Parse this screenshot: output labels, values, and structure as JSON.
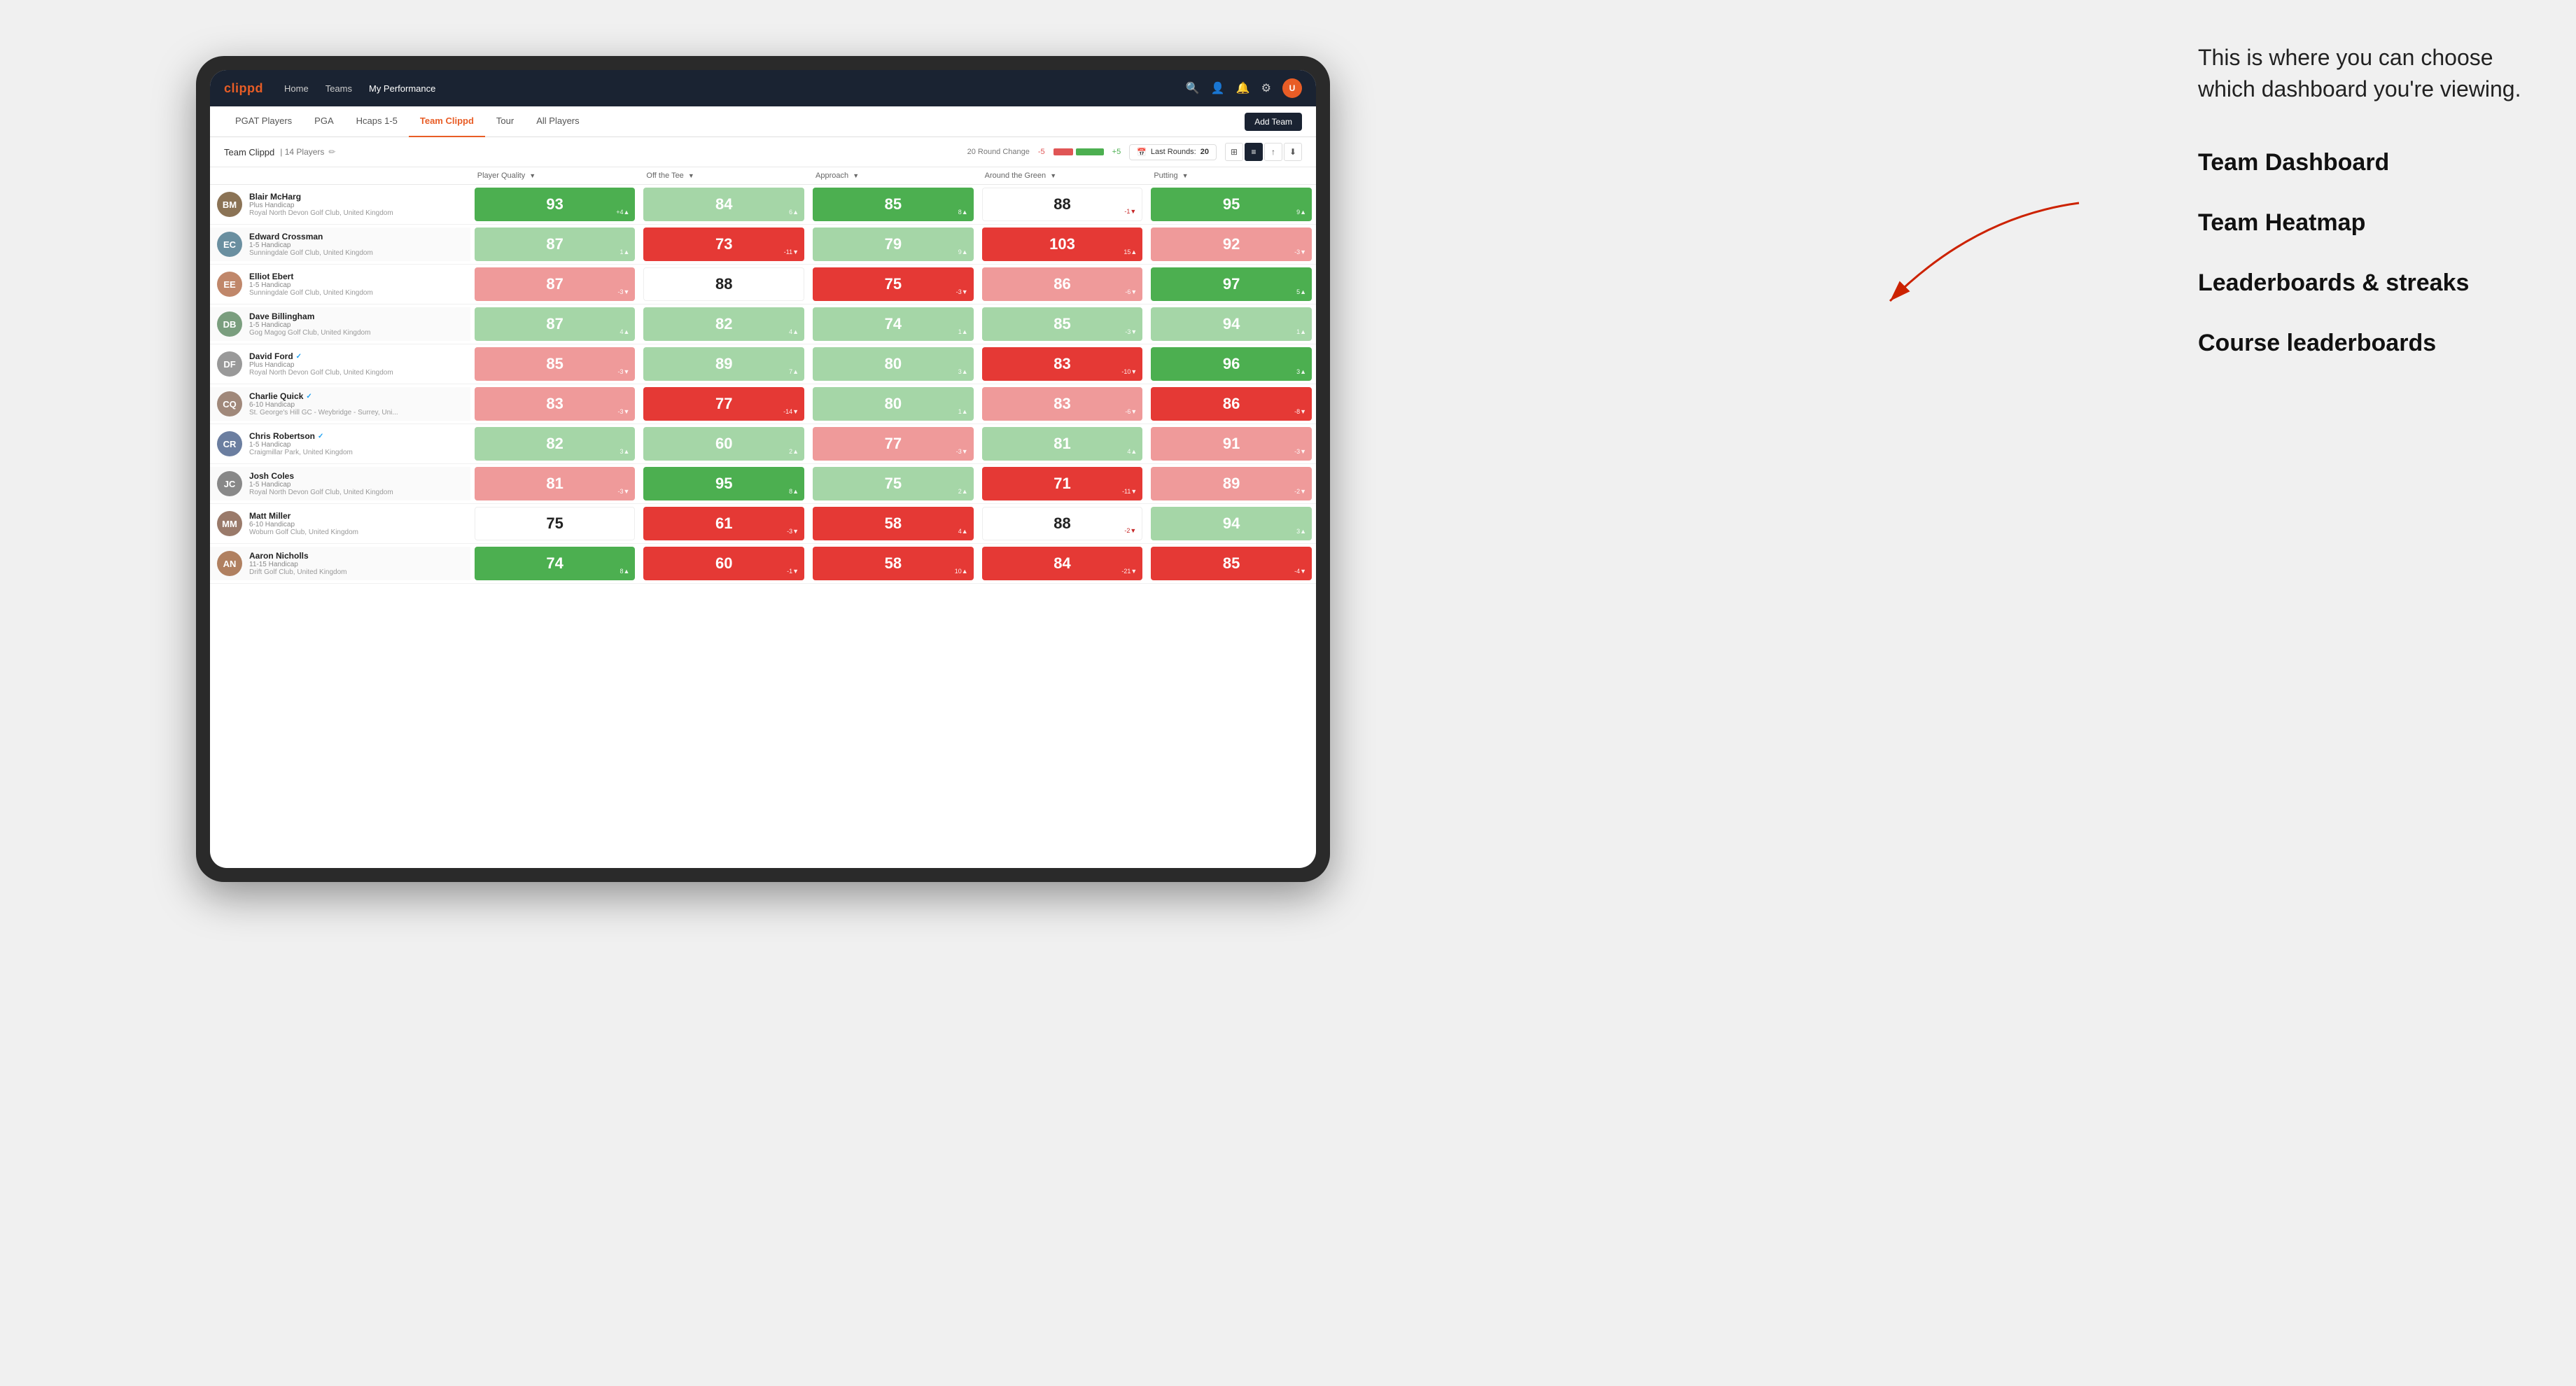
{
  "annotation": {
    "intro": "This is where you can choose which dashboard you're viewing.",
    "options": [
      "Team Dashboard",
      "Team Heatmap",
      "Leaderboards & streaks",
      "Course leaderboards"
    ]
  },
  "navbar": {
    "brand": "clippd",
    "nav_items": [
      "Home",
      "Teams",
      "My Performance"
    ],
    "active_nav": "My Performance"
  },
  "subnav": {
    "items": [
      "PGAT Players",
      "PGA",
      "Hcaps 1-5",
      "Team Clippd",
      "Tour",
      "All Players"
    ],
    "active_item": "Team Clippd",
    "add_team_label": "Add Team"
  },
  "team_header": {
    "name": "Team Clippd",
    "separator": "|",
    "count": "14 Players",
    "round_change_label": "20 Round Change",
    "minus": "-5",
    "plus": "+5",
    "last_rounds_label": "Last Rounds:",
    "last_rounds_value": "20"
  },
  "table": {
    "columns": [
      "Player Quality ↓",
      "Off the Tee ↓",
      "Approach ↓",
      "Around the Green ↓",
      "Putting ↓"
    ],
    "players": [
      {
        "name": "Blair McHarg",
        "handicap": "Plus Handicap",
        "club": "Royal North Devon Golf Club, United Kingdom",
        "avatar_color": "#8B7355",
        "initials": "BM",
        "scores": [
          {
            "value": 93,
            "change": "+4",
            "dir": "up",
            "bg": "green-dark"
          },
          {
            "value": 84,
            "change": "6",
            "dir": "up",
            "bg": "green-light"
          },
          {
            "value": 85,
            "change": "8",
            "dir": "up",
            "bg": "green-dark"
          },
          {
            "value": 88,
            "change": "-1",
            "dir": "down",
            "bg": "white"
          },
          {
            "value": 95,
            "change": "9",
            "dir": "up",
            "bg": "green-dark"
          }
        ]
      },
      {
        "name": "Edward Crossman",
        "handicap": "1-5 Handicap",
        "club": "Sunningdale Golf Club, United Kingdom",
        "avatar_color": "#6a8fa0",
        "initials": "EC",
        "scores": [
          {
            "value": 87,
            "change": "1",
            "dir": "up",
            "bg": "green-light"
          },
          {
            "value": 73,
            "change": "-11",
            "dir": "down",
            "bg": "red-dark"
          },
          {
            "value": 79,
            "change": "9",
            "dir": "up",
            "bg": "green-light"
          },
          {
            "value": 103,
            "change": "15",
            "dir": "up",
            "bg": "red-dark"
          },
          {
            "value": 92,
            "change": "-3",
            "dir": "down",
            "bg": "red-light"
          }
        ]
      },
      {
        "name": "Elliot Ebert",
        "handicap": "1-5 Handicap",
        "club": "Sunningdale Golf Club, United Kingdom",
        "avatar_color": "#c0876a",
        "initials": "EE",
        "scores": [
          {
            "value": 87,
            "change": "-3",
            "dir": "down",
            "bg": "red-light"
          },
          {
            "value": 88,
            "change": "",
            "dir": "",
            "bg": "white"
          },
          {
            "value": 75,
            "change": "-3",
            "dir": "down",
            "bg": "red-dark"
          },
          {
            "value": 86,
            "change": "-6",
            "dir": "down",
            "bg": "red-light"
          },
          {
            "value": 97,
            "change": "5",
            "dir": "up",
            "bg": "green-dark"
          }
        ]
      },
      {
        "name": "Dave Billingham",
        "handicap": "1-5 Handicap",
        "club": "Gog Magog Golf Club, United Kingdom",
        "avatar_color": "#7a9e7e",
        "initials": "DB",
        "scores": [
          {
            "value": 87,
            "change": "4",
            "dir": "up",
            "bg": "green-light"
          },
          {
            "value": 82,
            "change": "4",
            "dir": "up",
            "bg": "green-light"
          },
          {
            "value": 74,
            "change": "1",
            "dir": "up",
            "bg": "green-light"
          },
          {
            "value": 85,
            "change": "-3",
            "dir": "down",
            "bg": "green-light"
          },
          {
            "value": 94,
            "change": "1",
            "dir": "up",
            "bg": "green-light"
          }
        ]
      },
      {
        "name": "David Ford",
        "handicap": "Plus Handicap",
        "club": "Royal North Devon Golf Club, United Kingdom",
        "avatar_color": "#888",
        "initials": "DF",
        "verified": true,
        "scores": [
          {
            "value": 85,
            "change": "-3",
            "dir": "down",
            "bg": "red-light"
          },
          {
            "value": 89,
            "change": "7",
            "dir": "up",
            "bg": "green-light"
          },
          {
            "value": 80,
            "change": "3",
            "dir": "up",
            "bg": "green-light"
          },
          {
            "value": 83,
            "change": "-10",
            "dir": "down",
            "bg": "red-dark"
          },
          {
            "value": 96,
            "change": "3",
            "dir": "up",
            "bg": "green-dark"
          }
        ]
      },
      {
        "name": "Charlie Quick",
        "handicap": "6-10 Handicap",
        "club": "St. George's Hill GC - Weybridge - Surrey, Uni...",
        "avatar_color": "#a0887a",
        "initials": "CQ",
        "verified": true,
        "scores": [
          {
            "value": 83,
            "change": "-3",
            "dir": "down",
            "bg": "red-light"
          },
          {
            "value": 77,
            "change": "-14",
            "dir": "down",
            "bg": "red-dark"
          },
          {
            "value": 80,
            "change": "1",
            "dir": "up",
            "bg": "green-light"
          },
          {
            "value": 83,
            "change": "-6",
            "dir": "down",
            "bg": "red-light"
          },
          {
            "value": 86,
            "change": "-8",
            "dir": "down",
            "bg": "red-dark"
          }
        ]
      },
      {
        "name": "Chris Robertson",
        "handicap": "1-5 Handicap",
        "club": "Craigmillar Park, United Kingdom",
        "avatar_color": "#6b7ea0",
        "initials": "CR",
        "verified": true,
        "scores": [
          {
            "value": 82,
            "change": "3",
            "dir": "up",
            "bg": "green-light"
          },
          {
            "value": 60,
            "change": "2",
            "dir": "up",
            "bg": "green-light"
          },
          {
            "value": 77,
            "change": "-3",
            "dir": "down",
            "bg": "red-light"
          },
          {
            "value": 81,
            "change": "4",
            "dir": "up",
            "bg": "green-light"
          },
          {
            "value": 91,
            "change": "-3",
            "dir": "down",
            "bg": "red-light"
          }
        ]
      },
      {
        "name": "Josh Coles",
        "handicap": "1-5 Handicap",
        "club": "Royal North Devon Golf Club, United Kingdom",
        "avatar_color": "#888",
        "initials": "JC",
        "scores": [
          {
            "value": 81,
            "change": "-3",
            "dir": "down",
            "bg": "red-light"
          },
          {
            "value": 95,
            "change": "8",
            "dir": "up",
            "bg": "green-dark"
          },
          {
            "value": 75,
            "change": "2",
            "dir": "up",
            "bg": "green-light"
          },
          {
            "value": 71,
            "change": "-11",
            "dir": "down",
            "bg": "red-dark"
          },
          {
            "value": 89,
            "change": "-2",
            "dir": "down",
            "bg": "red-light"
          }
        ]
      },
      {
        "name": "Matt Miller",
        "handicap": "6-10 Handicap",
        "club": "Woburn Golf Club, United Kingdom",
        "avatar_color": "#9a7a6a",
        "initials": "MM",
        "scores": [
          {
            "value": 75,
            "change": "",
            "dir": "",
            "bg": "white"
          },
          {
            "value": 61,
            "change": "-3",
            "dir": "down",
            "bg": "red-dark"
          },
          {
            "value": 58,
            "change": "4",
            "dir": "up",
            "bg": "red-dark"
          },
          {
            "value": 88,
            "change": "-2",
            "dir": "down",
            "bg": "white"
          },
          {
            "value": 94,
            "change": "3",
            "dir": "up",
            "bg": "green-light"
          }
        ]
      },
      {
        "name": "Aaron Nicholls",
        "handicap": "11-15 Handicap",
        "club": "Drift Golf Club, United Kingdom",
        "avatar_color": "#b08060",
        "initials": "AN",
        "scores": [
          {
            "value": 74,
            "change": "8",
            "dir": "up",
            "bg": "green-dark"
          },
          {
            "value": 60,
            "change": "-1",
            "dir": "down",
            "bg": "red-dark"
          },
          {
            "value": 58,
            "change": "10",
            "dir": "up",
            "bg": "red-dark"
          },
          {
            "value": 84,
            "change": "-21",
            "dir": "down",
            "bg": "red-dark"
          },
          {
            "value": 85,
            "change": "-4",
            "dir": "down",
            "bg": "red-dark"
          }
        ]
      }
    ]
  }
}
